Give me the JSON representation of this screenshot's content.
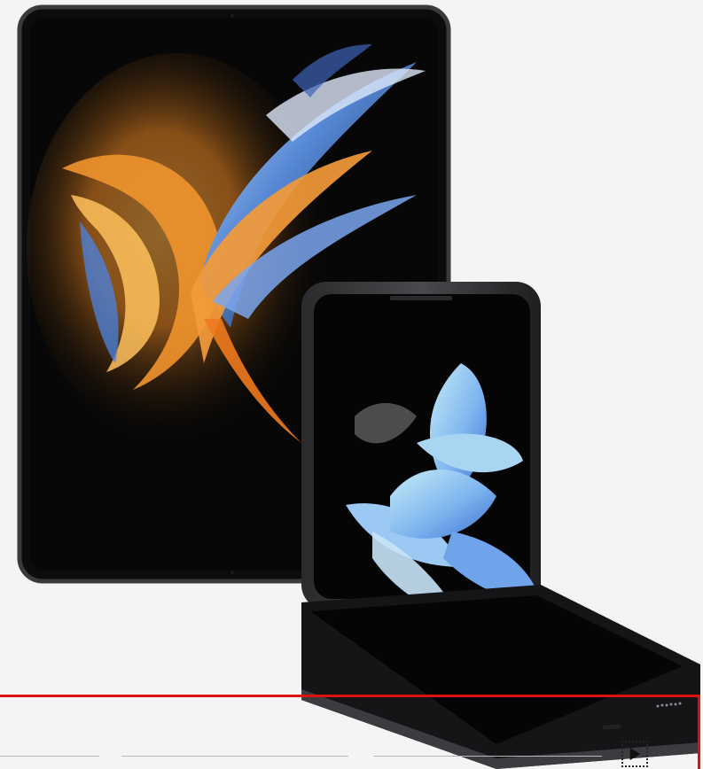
{
  "hero": {
    "image_alt": "",
    "background_color": "#f4f4f4"
  },
  "carousel": {
    "indicators": [
      {
        "state": "inactive"
      },
      {
        "state": "inactive"
      },
      {
        "state": "inactive"
      }
    ],
    "play_button": {
      "icon": "play-icon",
      "state": "paused"
    },
    "accent_color": "#e01010"
  }
}
